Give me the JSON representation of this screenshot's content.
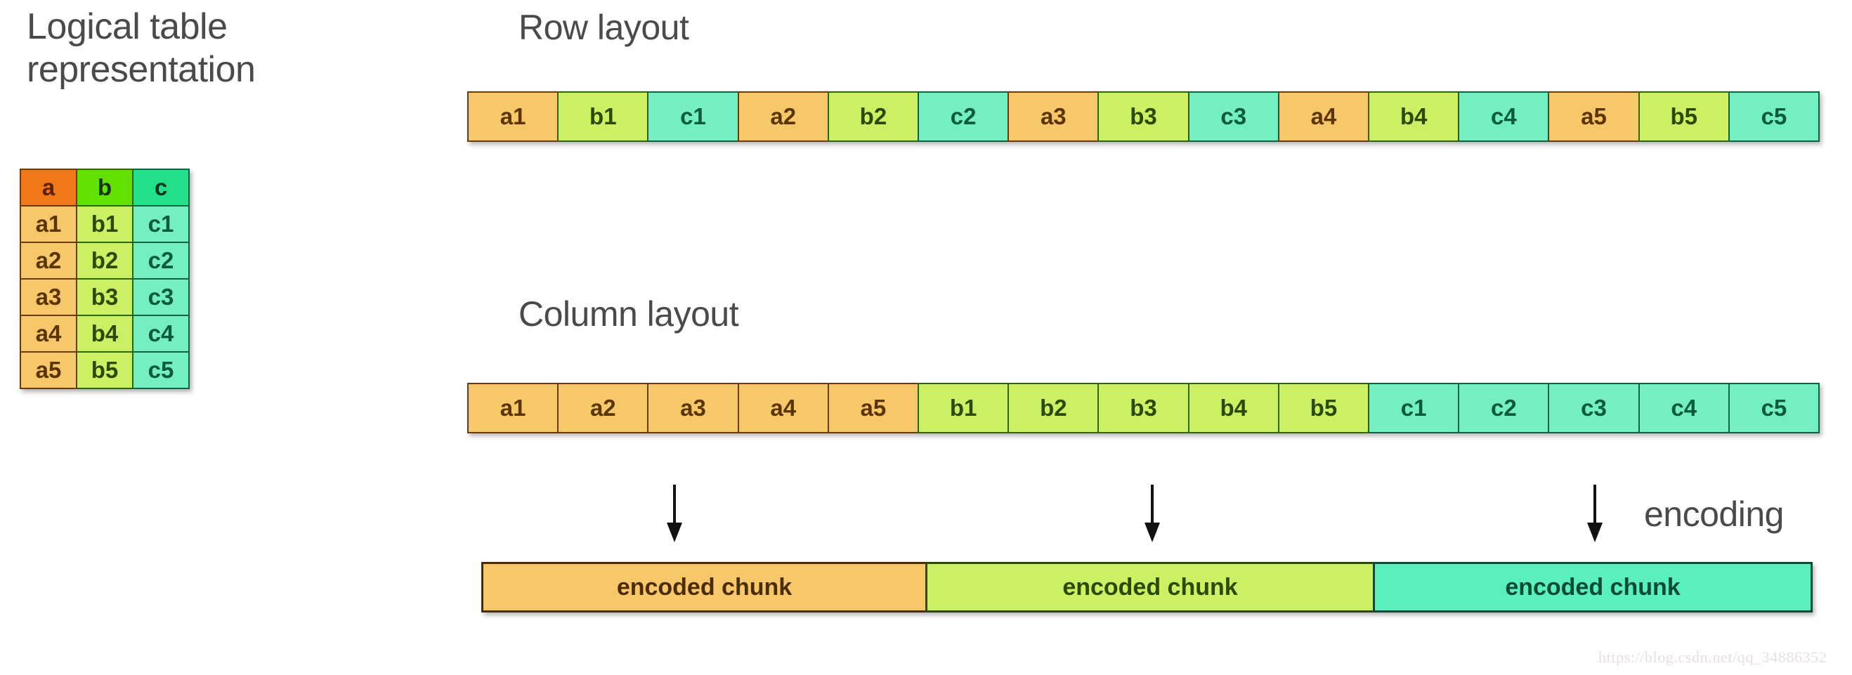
{
  "left": {
    "title": "Logical table\nrepresentation",
    "table": {
      "headers": [
        "a",
        "b",
        "c"
      ],
      "rows": [
        [
          "a1",
          "b1",
          "c1"
        ],
        [
          "a2",
          "b2",
          "c2"
        ],
        [
          "a3",
          "b3",
          "c3"
        ],
        [
          "a4",
          "b4",
          "c4"
        ],
        [
          "a5",
          "b5",
          "c5"
        ]
      ]
    }
  },
  "row_layout": {
    "title": "Row layout",
    "cells": [
      {
        "label": "a1",
        "kind": "a"
      },
      {
        "label": "b1",
        "kind": "b"
      },
      {
        "label": "c1",
        "kind": "c"
      },
      {
        "label": "a2",
        "kind": "a"
      },
      {
        "label": "b2",
        "kind": "b"
      },
      {
        "label": "c2",
        "kind": "c"
      },
      {
        "label": "a3",
        "kind": "a"
      },
      {
        "label": "b3",
        "kind": "b"
      },
      {
        "label": "c3",
        "kind": "c"
      },
      {
        "label": "a4",
        "kind": "a"
      },
      {
        "label": "b4",
        "kind": "b"
      },
      {
        "label": "c4",
        "kind": "c"
      },
      {
        "label": "a5",
        "kind": "a"
      },
      {
        "label": "b5",
        "kind": "b"
      },
      {
        "label": "c5",
        "kind": "c"
      }
    ]
  },
  "column_layout": {
    "title": "Column layout",
    "cells": [
      {
        "label": "a1",
        "kind": "a"
      },
      {
        "label": "a2",
        "kind": "a"
      },
      {
        "label": "a3",
        "kind": "a"
      },
      {
        "label": "a4",
        "kind": "a"
      },
      {
        "label": "a5",
        "kind": "a"
      },
      {
        "label": "b1",
        "kind": "b"
      },
      {
        "label": "b2",
        "kind": "b"
      },
      {
        "label": "b3",
        "kind": "b"
      },
      {
        "label": "b4",
        "kind": "b"
      },
      {
        "label": "b5",
        "kind": "b"
      },
      {
        "label": "c1",
        "kind": "c"
      },
      {
        "label": "c2",
        "kind": "c"
      },
      {
        "label": "c3",
        "kind": "c"
      },
      {
        "label": "c4",
        "kind": "c"
      },
      {
        "label": "c5",
        "kind": "c"
      }
    ]
  },
  "encoding": {
    "label": "encoding",
    "chunks": [
      {
        "label": "encoded chunk",
        "kind": "a"
      },
      {
        "label": "encoded chunk",
        "kind": "b"
      },
      {
        "label": "encoded chunk",
        "kind": "c"
      }
    ],
    "arrow_glyph": "down-arrow"
  },
  "watermark": "https://blog.csdn.net/qq_34886352",
  "colors": {
    "header_a": "#F07818",
    "header_b": "#62E000",
    "header_c": "#22E08A",
    "cell_a": "#F7C86A",
    "cell_b": "#CBF064",
    "cell_c": "#74EFC2",
    "text": "#4a4a4a",
    "background": "#FFFFFF"
  }
}
